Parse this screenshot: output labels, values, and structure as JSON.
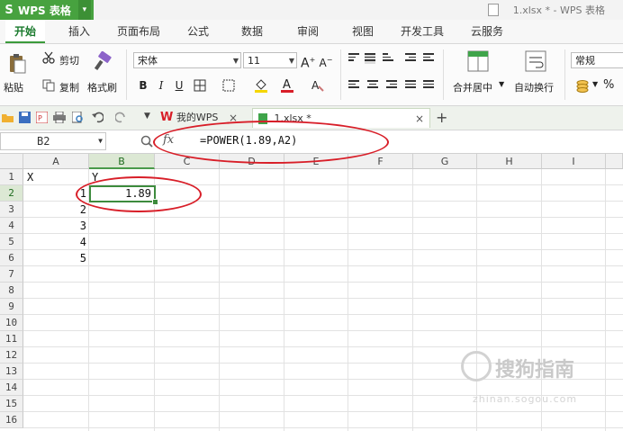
{
  "app": {
    "logo": "S",
    "name": "WPS 表格",
    "dropdown_arrow": "▾"
  },
  "window_title": "1.xlsx * - WPS 表格",
  "ribbon_tabs": [
    "开始",
    "插入",
    "页面布局",
    "公式",
    "数据",
    "审阅",
    "视图",
    "开发工具",
    "云服务"
  ],
  "ribbon": {
    "paste_label": "粘贴",
    "cut_label": "剪切",
    "copy_label": "复制",
    "format_painter_label": "格式刷",
    "font_name": "宋体",
    "font_size": "11",
    "merge_center_label": "合并居中",
    "wrap_text_label": "自动换行",
    "number_format": "常规",
    "percent": "%",
    "bold": "B",
    "italic": "I",
    "underline": "U"
  },
  "doc_tabs": [
    {
      "label": "我的WPS",
      "close": "×"
    },
    {
      "label": "1.xlsx *",
      "close": "×"
    }
  ],
  "new_tab": "+",
  "formula_bar": {
    "cell_ref": "B2",
    "fx": "fx",
    "formula": "=POWER(1.89,A2)"
  },
  "columns": [
    "A",
    "B",
    "C",
    "D",
    "E",
    "F",
    "G",
    "H",
    "I"
  ],
  "rows": [
    "1",
    "2",
    "3",
    "4",
    "5",
    "6",
    "7",
    "8",
    "9",
    "10",
    "11",
    "12",
    "13",
    "14",
    "15",
    "16"
  ],
  "cells": {
    "A1": "X",
    "B1": "Y",
    "A2": "1",
    "B2": "1.89",
    "A3": "2",
    "A4": "3",
    "A5": "4",
    "A6": "5"
  },
  "active_cell": "B2",
  "accent_color": "#47a23f",
  "annotation_color": "#d81e28",
  "watermark": {
    "text": "搜狗指南",
    "url": "zhinan.sogou.com"
  }
}
